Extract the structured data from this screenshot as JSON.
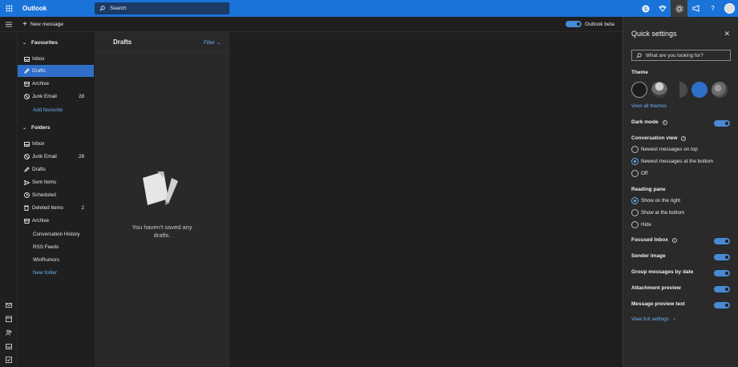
{
  "topbar": {
    "app_title": "Outlook",
    "search_placeholder": "Search",
    "icons": [
      "waffle-icon",
      "skype-icon",
      "rewards-icon",
      "gear-icon",
      "megaphone-icon",
      "help-icon",
      "avatar"
    ]
  },
  "cmdbar": {
    "new_message": "New message",
    "beta_label": "Outlook beta"
  },
  "nav": {
    "favourites_header": "Favourites",
    "favourites": [
      {
        "label": "Inbox",
        "icon": "inbox-icon",
        "count": ""
      },
      {
        "label": "Drafts",
        "icon": "pencil-icon",
        "count": ""
      },
      {
        "label": "Archive",
        "icon": "archive-icon",
        "count": ""
      },
      {
        "label": "Junk Email",
        "icon": "block-icon",
        "count": "28"
      }
    ],
    "add_favourite": "Add favourite",
    "folders_header": "Folders",
    "folders": [
      {
        "label": "Inbox",
        "icon": "inbox-icon",
        "count": ""
      },
      {
        "label": "Junk Email",
        "icon": "block-icon",
        "count": "28"
      },
      {
        "label": "Drafts",
        "icon": "pencil-icon",
        "count": ""
      },
      {
        "label": "Sent Items",
        "icon": "send-icon",
        "count": ""
      },
      {
        "label": "Scheduled",
        "icon": "clock-icon",
        "count": ""
      },
      {
        "label": "Deleted Items",
        "icon": "trash-icon",
        "count": "2"
      },
      {
        "label": "Archive",
        "icon": "archive-icon",
        "count": ""
      }
    ],
    "subfolders": [
      "Conversation History",
      "RSS Feeds",
      "WinRumors"
    ],
    "new_folder": "New folder"
  },
  "list": {
    "title": "Drafts",
    "filter": "Filter",
    "empty_line1": "You haven't saved any",
    "empty_line2": "drafts."
  },
  "quick_settings": {
    "title": "Quick settings",
    "search_placeholder": "What are you looking for?",
    "theme_label": "Theme",
    "view_all_themes": "View all themes",
    "dark_mode": "Dark mode",
    "conversation_view": "Conversation view",
    "conversation_options": [
      "Newest messages on top",
      "Newest messages at the bottom",
      "Off"
    ],
    "conversation_selected": 1,
    "reading_pane": "Reading pane",
    "reading_options": [
      "Show on the right",
      "Show at the bottom",
      "Hide"
    ],
    "reading_selected": 0,
    "focused_inbox": "Focused Inbox",
    "sender_image": "Sender image",
    "group_by_date": "Group messages by date",
    "attachment_preview": "Attachment preview",
    "message_preview": "Message preview text",
    "view_full": "View full settings",
    "accent_color": "#2f6fc9"
  }
}
